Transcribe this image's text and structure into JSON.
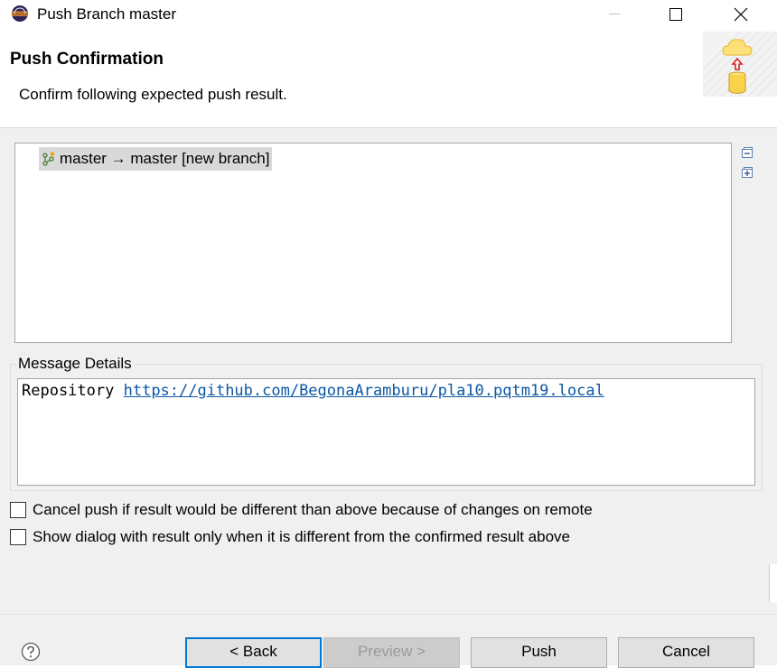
{
  "window": {
    "title": "Push Branch master"
  },
  "banner": {
    "title": "Push Confirmation",
    "description": "Confirm following expected push result."
  },
  "push_results": {
    "items": [
      {
        "label": "master → master [new branch]",
        "selected": true
      }
    ]
  },
  "message_details": {
    "label": "Message Details",
    "key": "Repository",
    "url": "https://github.com/BegonaAramburu/pla10.pqtm19.local"
  },
  "options": {
    "cancel_if_different": {
      "label": "Cancel push if result would be different than above because of changes on remote",
      "checked": false
    },
    "show_only_if_different": {
      "label": "Show dialog with result only when it is different from the confirmed result above",
      "checked": false
    }
  },
  "buttons": {
    "back": "< Back",
    "preview": "Preview >",
    "push": "Push",
    "cancel": "Cancel"
  },
  "colors": {
    "accent": "#0078d7",
    "link": "#0b57a4",
    "selection": "#d9d9d9"
  }
}
